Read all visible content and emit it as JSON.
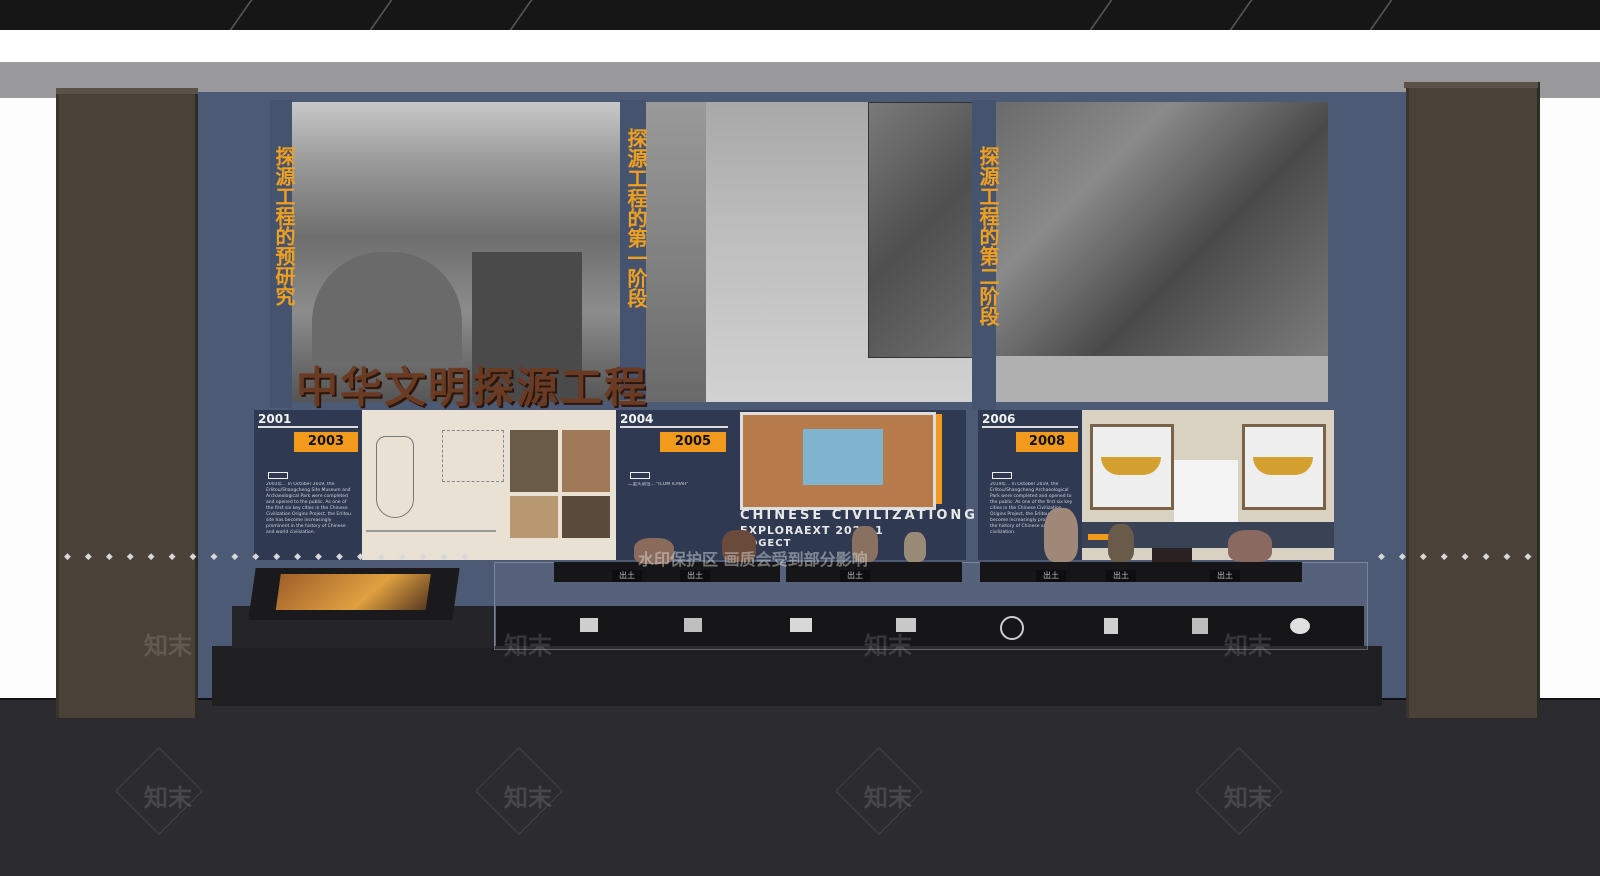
{
  "title": "中华文明探源工程",
  "vertical_titles": {
    "left": "探源工程的预研究",
    "middle": "探源工程的第一阶段",
    "right": "探源工程的第二阶段"
  },
  "panels": [
    {
      "year_small": "2001",
      "year_box": "2003",
      "body": "2001年... In October 2019, the Erlitou/Shangcheng Site Museum and Archaeological Park were completed and opened to the public. As one of the first six key cities in the Chinese Civilization Origins Project, the Erlitou site has become increasingly prominent in the history of Chinese and world civilization."
    },
    {
      "year_small": "2004",
      "year_box": "2005",
      "body": "二里头遗址... \"ICOM ICMAH\""
    },
    {
      "year_small": "2006",
      "year_box": "2008",
      "body": "2019年... In October 2019, the Erlitou/Shangcheng Archaeological Park were completed and opened to the public. As one of the first six key cities in the Chinese Civilization Origins Project, the Erlitou site has become increasingly prominent in the history of Chinese and world civilization."
    }
  ],
  "english_banner": {
    "line1": "CHINESE CIVILIZATIONG",
    "line2": "EXPLORAEXT  2020.1",
    "line3": "ROGECT"
  },
  "label_plates": [
    "出土",
    "出土",
    "出土",
    "出土",
    "出土",
    "出土"
  ],
  "watermarks": {
    "brand": "知末",
    "notice": "水印保护区 画质会受到部分影响"
  },
  "colors": {
    "accent_orange": "#f29a1c",
    "wall_blue": "#4d5a75",
    "title_brown": "#6b3a22"
  }
}
